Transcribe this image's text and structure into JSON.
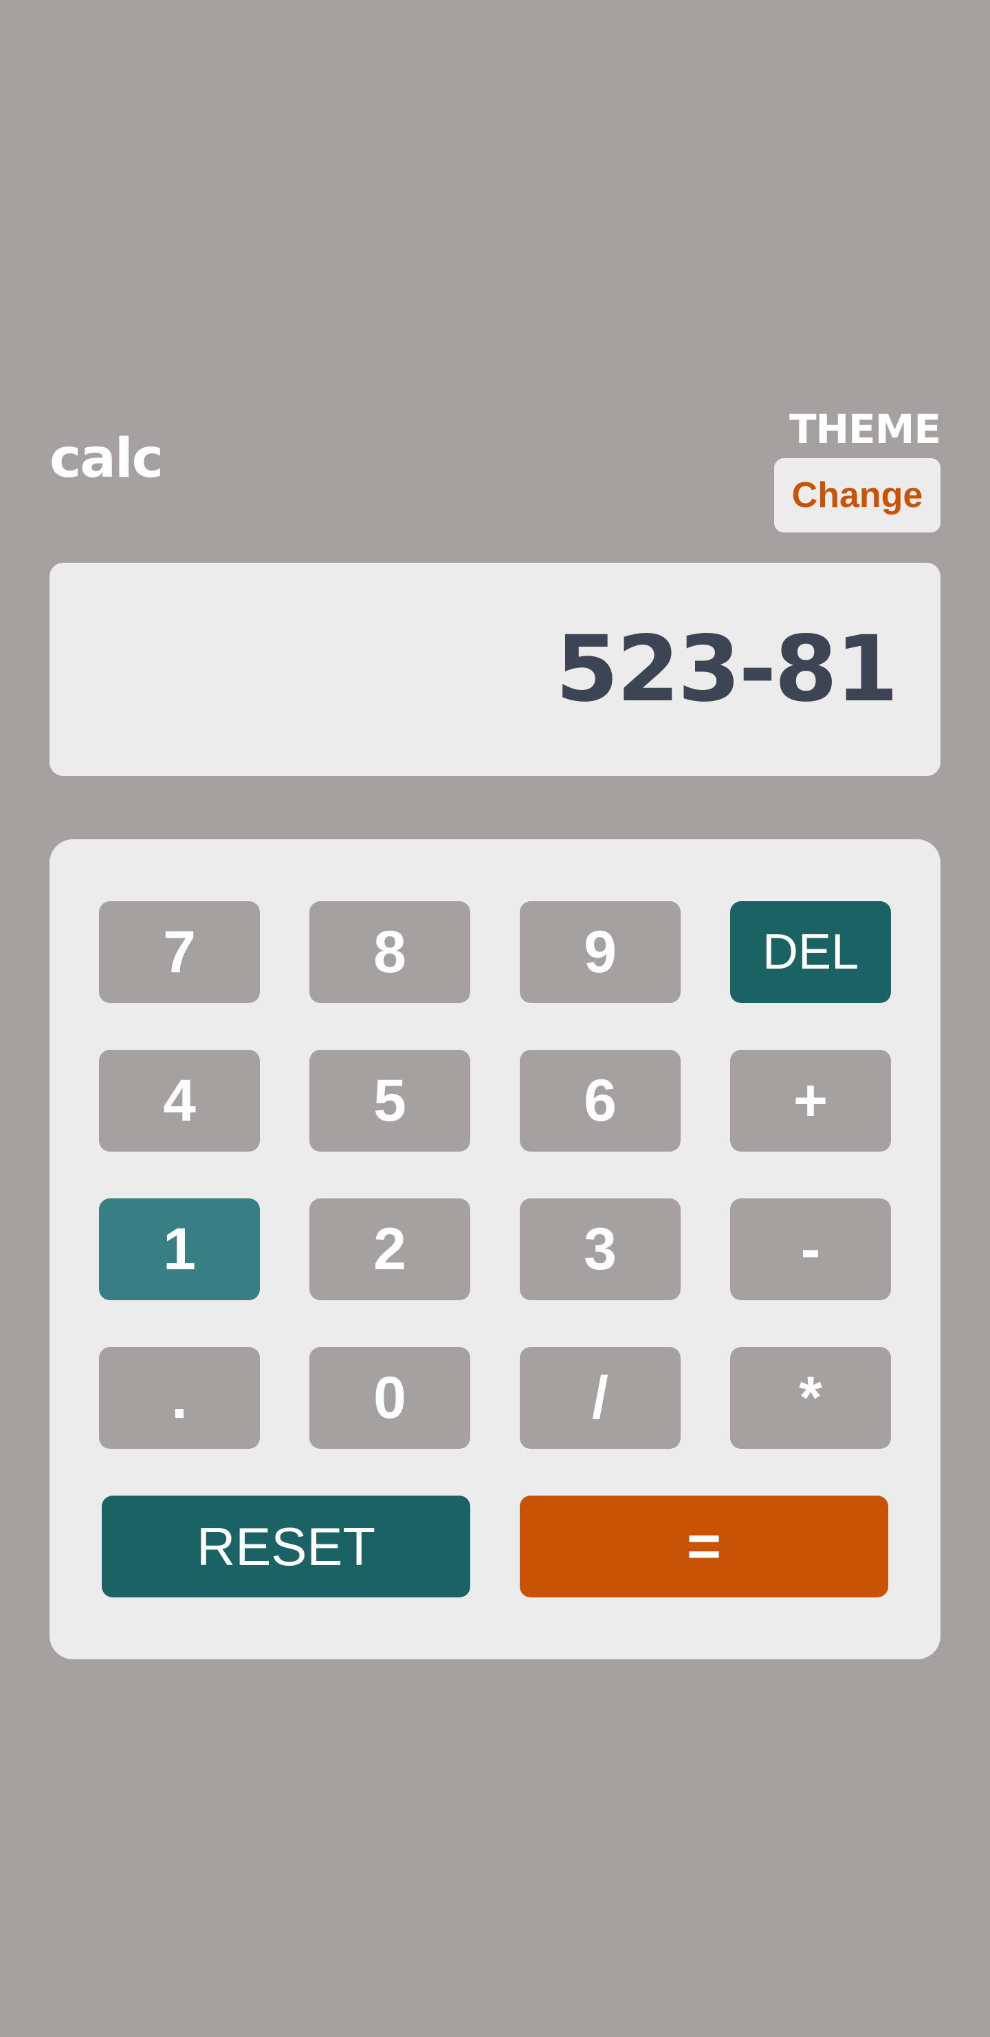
{
  "header": {
    "logo": "calc",
    "theme_label": "THEME",
    "theme_button": "Change"
  },
  "display": {
    "value": "523-81"
  },
  "keys": {
    "k7": "7",
    "k8": "8",
    "k9": "9",
    "del": "DEL",
    "k4": "4",
    "k5": "5",
    "k6": "6",
    "plus": "+",
    "k1": "1",
    "k2": "2",
    "k3": "3",
    "minus": "-",
    "dot": ".",
    "k0": "0",
    "divide": "/",
    "multiply": "*",
    "reset": "RESET",
    "equals": "="
  },
  "colors": {
    "background": "#a5a1a0",
    "panel": "#ececec",
    "key": "#a5a1a0",
    "accent_teal": "#1b6265",
    "active_key": "#377f84",
    "accent_orange": "#c85305",
    "display_text": "#3d4555"
  },
  "state": {
    "active_key": "1"
  }
}
